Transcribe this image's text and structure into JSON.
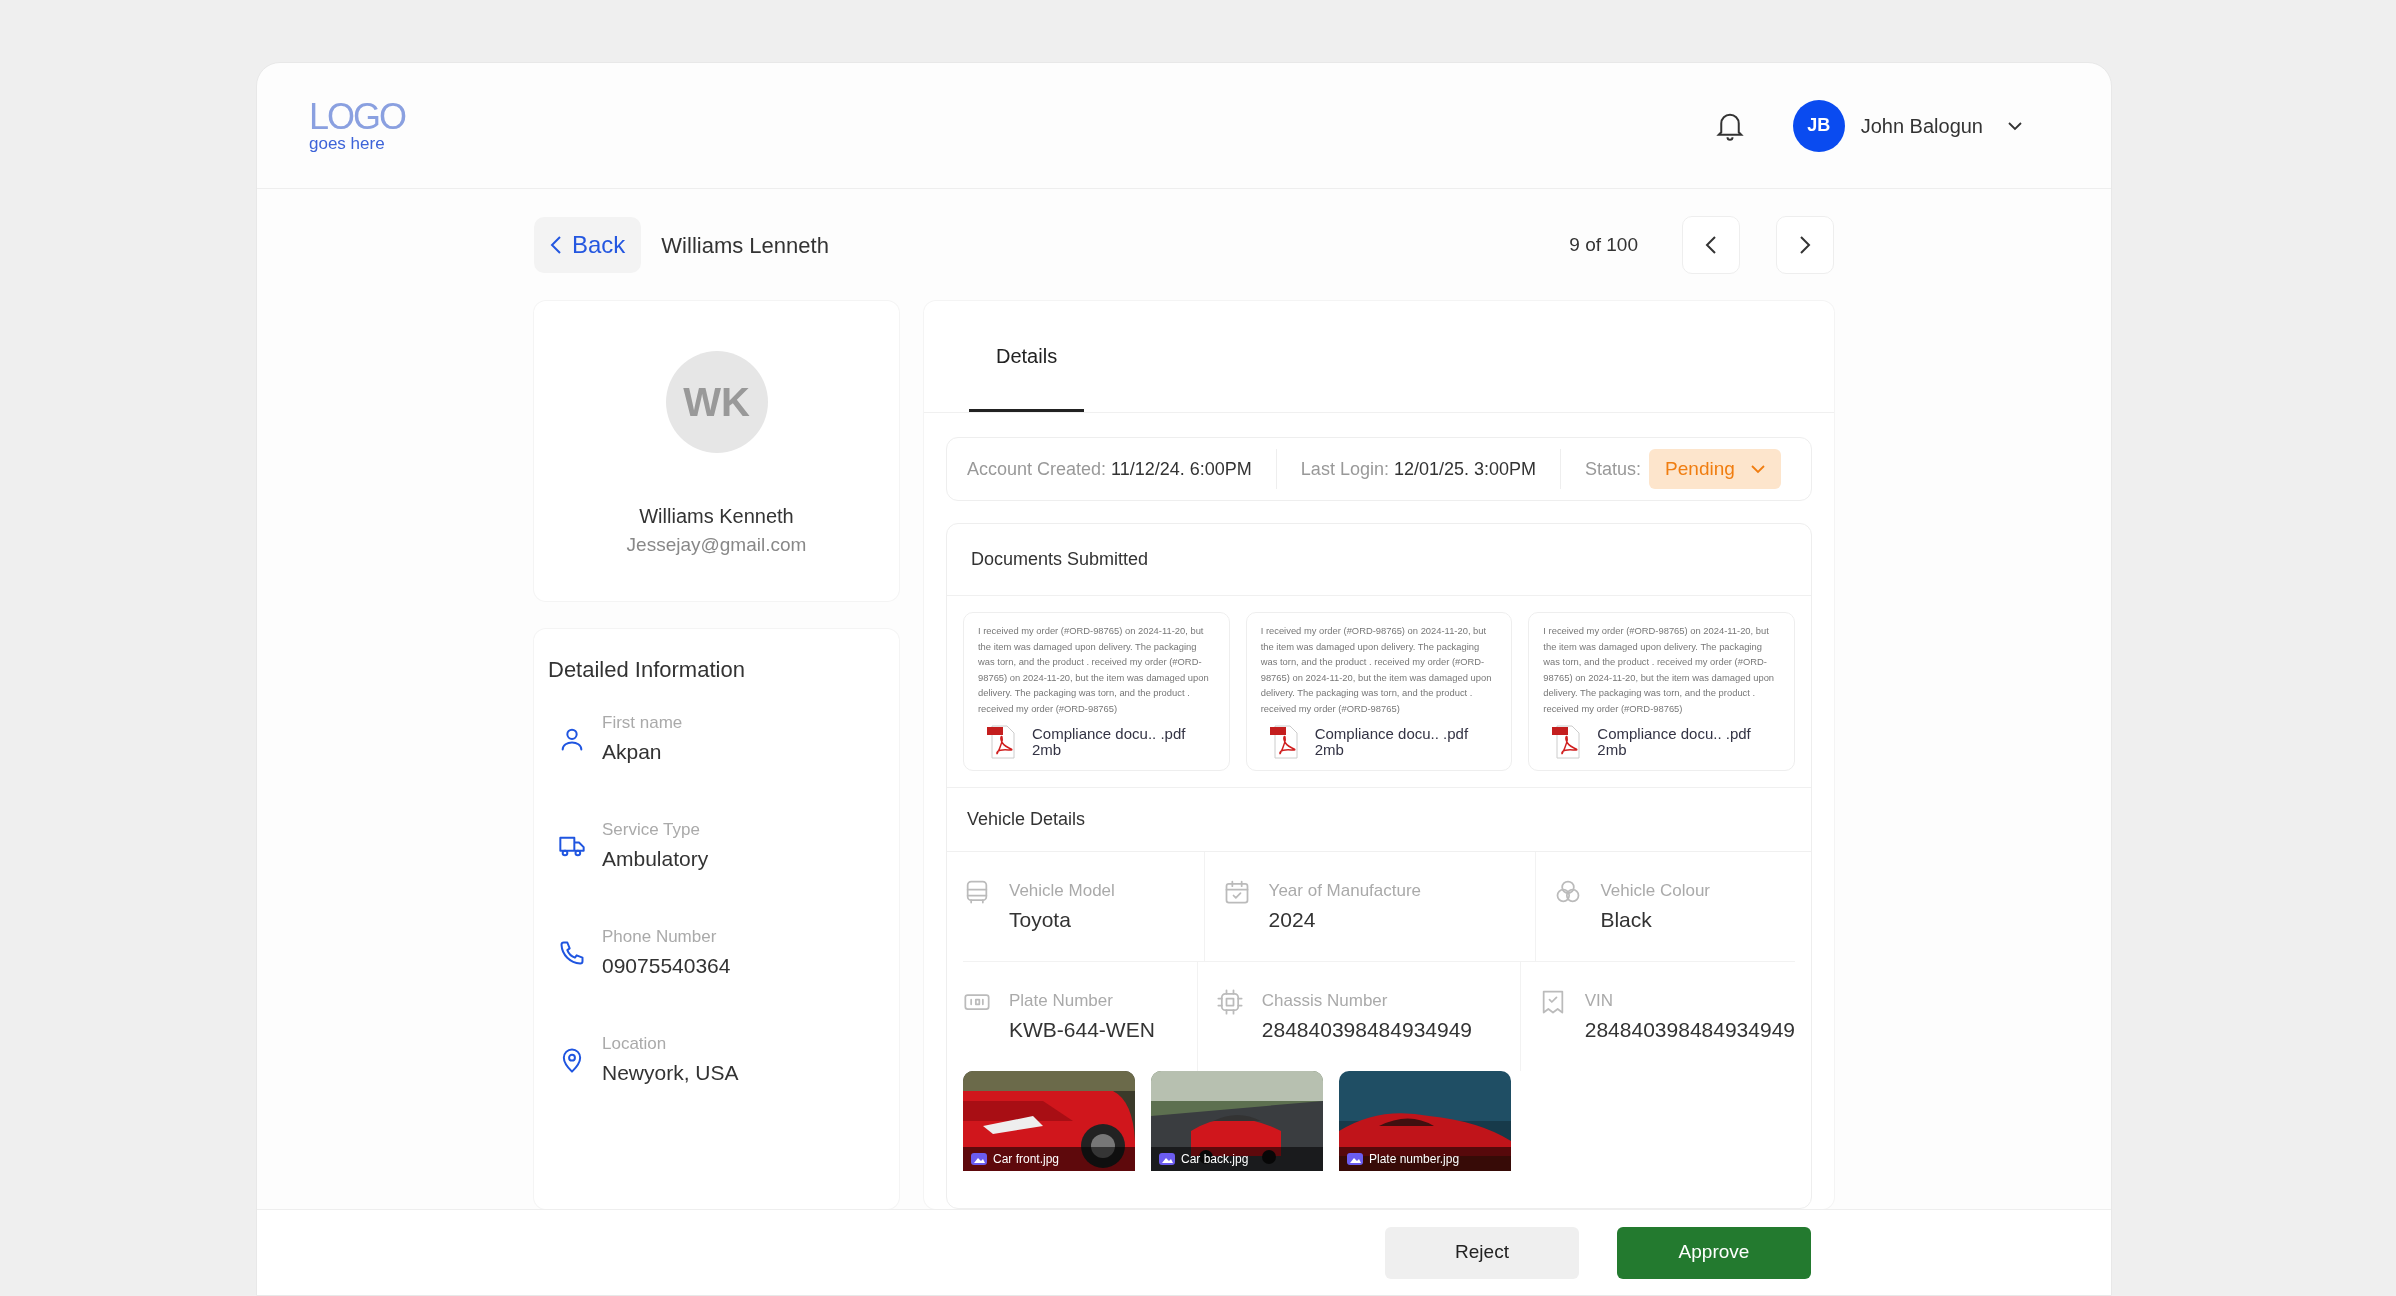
{
  "logo": {
    "main": "LOGO",
    "sub": "goes here"
  },
  "user": {
    "initials": "JB",
    "name": "John Balogun"
  },
  "nav": {
    "back": "Back",
    "title": "Williams Lenneth",
    "counter": "9 of 100"
  },
  "profile": {
    "initials": "WK",
    "name": "Williams Kenneth",
    "email": "Jessejay@gmail.com"
  },
  "detailed_info": {
    "title": "Detailed Information",
    "items": [
      {
        "kind": "person",
        "label": "First name",
        "value": "Akpan"
      },
      {
        "kind": "truck",
        "label": "Service Type",
        "value": "Ambulatory"
      },
      {
        "kind": "phone",
        "label": "Phone Number",
        "value": "09075540364"
      },
      {
        "kind": "pin",
        "label": "Location",
        "value": "Newyork, USA"
      }
    ]
  },
  "tabs": [
    {
      "label": "Details",
      "selected": true
    }
  ],
  "account": {
    "created_label": "Account Created:",
    "created": "11/12/24. 6:00PM",
    "login_label": "Last Login:",
    "login": "12/01/25. 3:00PM",
    "status_label": "Status:",
    "status": "Pending"
  },
  "documents": {
    "title": "Documents Submitted",
    "items": [
      {
        "preview": "I received my order (#ORD-98765) on 2024-11-20, but the item was damaged upon delivery. The packaging was torn, and the product .  received my order (#ORD-98765) on 2024-11-20, but the item was damaged upon delivery. The packaging was torn, and the product .  received my order (#ORD-98765)",
        "name": "Compliance docu.. .pdf",
        "size": "2mb"
      },
      {
        "preview": "I received my order (#ORD-98765) on 2024-11-20, but the item was damaged upon delivery. The packaging was torn, and the product .  received my order (#ORD-98765) on 2024-11-20, but the item was damaged upon delivery. The packaging was torn, and the product .  received my order (#ORD-98765)",
        "name": "Compliance docu.. .pdf",
        "size": "2mb"
      },
      {
        "preview": "I received my order (#ORD-98765) on 2024-11-20, but the item was damaged upon delivery. The packaging was torn, and the product .  received my order (#ORD-98765) on 2024-11-20, but the item was damaged upon delivery. The packaging was torn, and the product .  received my order (#ORD-98765)",
        "name": "Compliance docu.. .pdf",
        "size": "2mb"
      }
    ]
  },
  "vehicle": {
    "title": "Vehicle Details",
    "fields": [
      {
        "kind": "bus",
        "label": "Vehicle Model",
        "value": "Toyota"
      },
      {
        "kind": "calendar",
        "label": "Year of Manufacture",
        "value": "2024"
      },
      {
        "kind": "colour",
        "label": "Vehicle Colour",
        "value": "Black"
      },
      {
        "kind": "plate",
        "label": "Plate Number",
        "value": "KWB-644-WEN"
      },
      {
        "kind": "chip",
        "label": "Chassis Number",
        "value": "284840398484934949"
      },
      {
        "kind": "receipt",
        "label": "VIN",
        "value": "284840398484934949"
      }
    ],
    "photos": [
      {
        "kind": "front",
        "caption": "Car front.jpg"
      },
      {
        "kind": "back",
        "caption": "Car back.jpg"
      },
      {
        "kind": "plate",
        "caption": "Plate number.jpg"
      }
    ]
  },
  "actions": [
    {
      "kind": "secondary",
      "label": "Reject"
    },
    {
      "kind": "primary",
      "label": "Approve"
    }
  ]
}
